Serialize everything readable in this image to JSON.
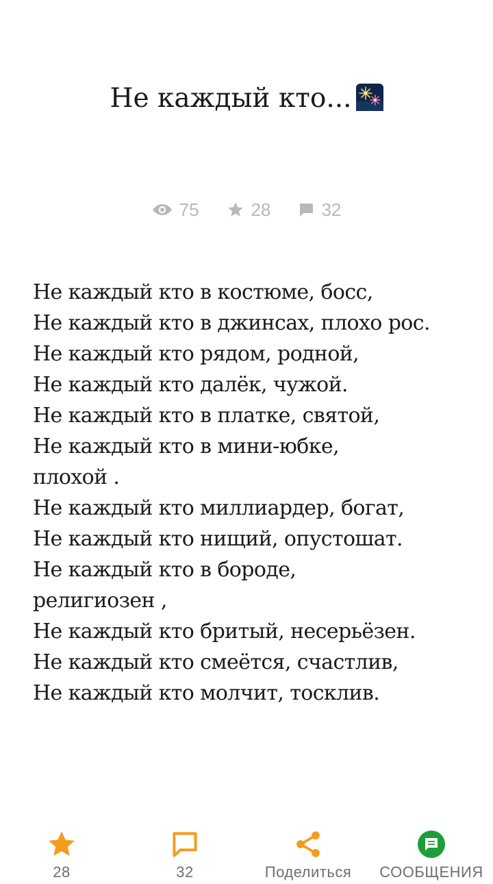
{
  "post": {
    "title": "Не каждый кто...",
    "title_emoji": "sparkler-night-icon"
  },
  "stats": {
    "views": "75",
    "stars": "28",
    "comments": "32"
  },
  "poem": {
    "lines": [
      "Не каждый кто в костюме, босс,",
      "Не каждый кто в джинсах, плохо рос.",
      "Не каждый кто рядом, родной,",
      "Не каждый кто далёк, чужой.",
      "Не каждый кто в платке, святой,",
      "Не каждый кто в мини-юбке,",
      "плохой .",
      "Не каждый кто миллиардер, богат,",
      "Не каждый кто нищий, опустошат.",
      "Не каждый кто в бороде,",
      "религиозен ,",
      "Не каждый кто бритый, несерьёзен.",
      "Не каждый кто смеётся, счастлив,",
      "Не каждый кто молчит, тосклив."
    ]
  },
  "bottom_bar": {
    "like_count": "28",
    "comments_count": "32",
    "share_label": "Поделиться",
    "messages_label": "СООБЩЕНИЯ"
  },
  "colors": {
    "accent": "#f39c1f",
    "messages_green": "#1e9e3a",
    "stat_gray": "#b8b8b8",
    "text": "#1a1a1a"
  }
}
